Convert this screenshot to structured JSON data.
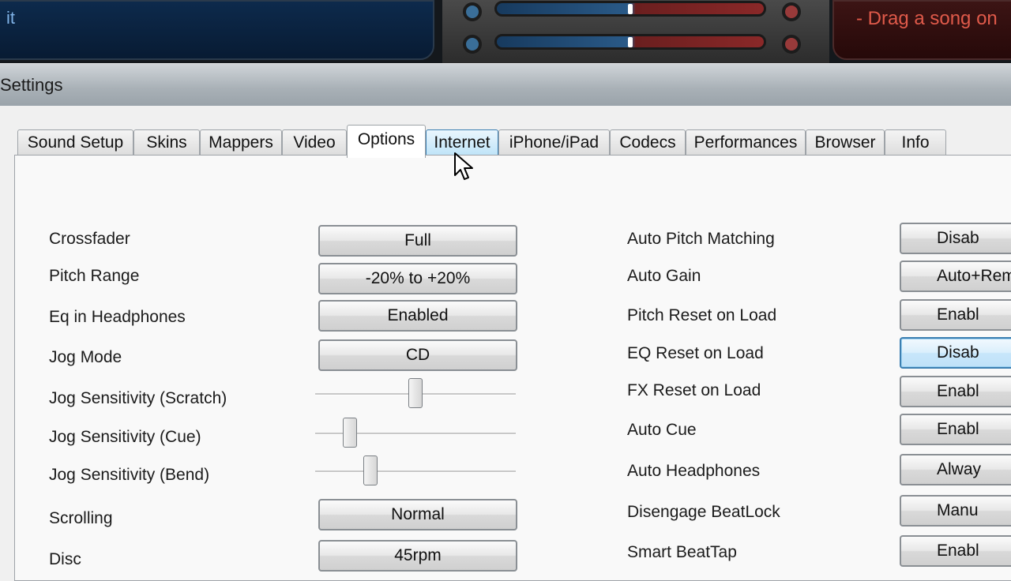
{
  "app": {
    "left_deck_text": "it",
    "right_deck_text": "- Drag a song on"
  },
  "window": {
    "title": "Settings"
  },
  "tabs": [
    {
      "label": "Sound Setup"
    },
    {
      "label": "Skins"
    },
    {
      "label": "Mappers"
    },
    {
      "label": "Video"
    },
    {
      "label": "Options"
    },
    {
      "label": "Internet"
    },
    {
      "label": "iPhone/iPad"
    },
    {
      "label": "Codecs"
    },
    {
      "label": "Performances"
    },
    {
      "label": "Browser"
    },
    {
      "label": "Info"
    }
  ],
  "left_options": {
    "crossfader": {
      "label": "Crossfader",
      "value": "Full"
    },
    "pitch_range": {
      "label": "Pitch Range",
      "value": "-20% to +20%"
    },
    "eq_headphones": {
      "label": "Eq in Headphones",
      "value": "Enabled"
    },
    "jog_mode": {
      "label": "Jog Mode",
      "value": "CD"
    },
    "jog_scratch": {
      "label": "Jog Sensitivity (Scratch)",
      "level": 0.5
    },
    "jog_cue": {
      "label": "Jog Sensitivity (Cue)",
      "level": 0.15
    },
    "jog_bend": {
      "label": "Jog Sensitivity (Bend)",
      "level": 0.26
    },
    "scrolling": {
      "label": "Scrolling",
      "value": "Normal"
    },
    "disc": {
      "label": "Disc",
      "value": "45rpm"
    }
  },
  "right_options": {
    "auto_pitch": {
      "label": "Auto Pitch Matching",
      "value": "Disab"
    },
    "auto_gain": {
      "label": "Auto Gain",
      "value": "Auto+Rem"
    },
    "pitch_reset": {
      "label": "Pitch Reset on Load",
      "value": "Enabl"
    },
    "eq_reset": {
      "label": "EQ Reset on Load",
      "value": "Disab"
    },
    "fx_reset": {
      "label": "FX Reset on Load",
      "value": "Enabl"
    },
    "auto_cue": {
      "label": "Auto Cue",
      "value": "Enabl"
    },
    "auto_headphones": {
      "label": "Auto Headphones",
      "value": "Alway"
    },
    "disengage_beatlock": {
      "label": "Disengage BeatLock",
      "value": "Manu"
    },
    "smart_beattap": {
      "label": "Smart BeatTap",
      "value": "Enabl"
    }
  }
}
